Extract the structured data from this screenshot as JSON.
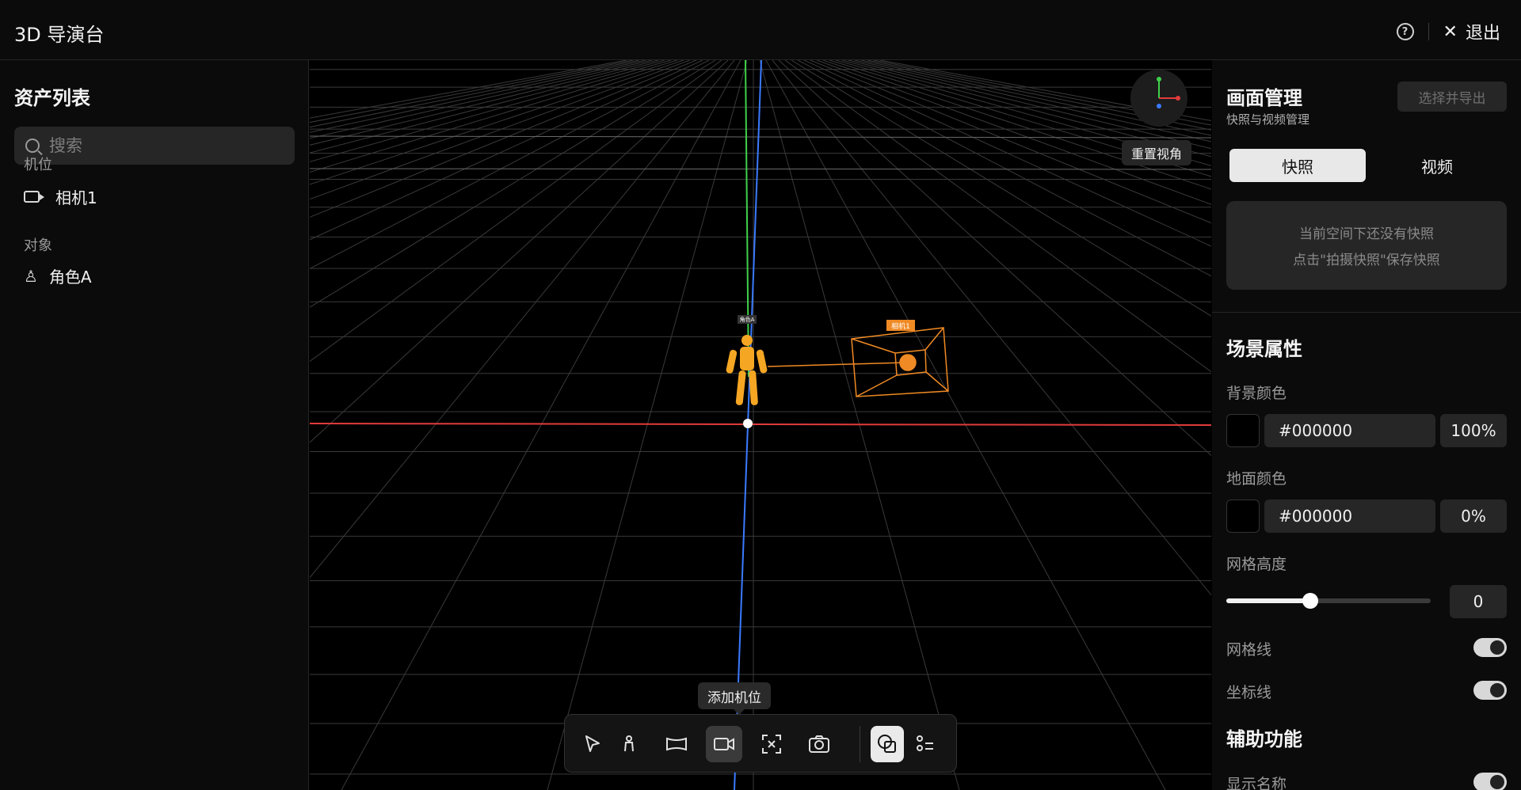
{
  "header": {
    "title": "3D 导演台",
    "exit_label": "退出",
    "help_glyph": "?",
    "close_glyph": "✕"
  },
  "assets": {
    "title": "资产列表",
    "search_placeholder": "搜索",
    "camera_section": "机位",
    "cameras": [
      "相机1"
    ],
    "object_section": "对象",
    "objects": [
      "角色A"
    ]
  },
  "viewport": {
    "reset_view_label": "重置视角",
    "character_tag": "角色A",
    "camera_tag": "相机1",
    "tooltip": "添加机位",
    "colors": {
      "x_axis": "#ff3b3b",
      "y_axis": "#3fd14a",
      "z_axis": "#3b7bff",
      "camera": "#f08a24",
      "character": "#f5a623"
    }
  },
  "toolbar": {
    "tools": [
      "select-icon",
      "character-icon",
      "scene-icon",
      "camera-icon",
      "frame-icon",
      "snapshot-icon",
      "layers-icon",
      "list-icon"
    ],
    "active_tool": "camera-icon"
  },
  "frame_mgmt": {
    "title": "画面管理",
    "subtitle": "快照与视频管理",
    "export_label": "选择并导出",
    "tab_snapshot": "快照",
    "tab_video": "视频",
    "empty_line1": "当前空间下还没有快照",
    "empty_line2": "点击\"拍摄快照\"保存快照"
  },
  "scene_props": {
    "title": "场景属性",
    "bg_label": "背景颜色",
    "bg_hex": "#000000",
    "bg_opacity": "100%",
    "ground_label": "地面颜色",
    "ground_hex": "#000000",
    "ground_opacity": "0%",
    "grid_height_label": "网格高度",
    "grid_height_value": "0",
    "grid_height_slider_fraction": 0.41,
    "grid_lines_label": "网格线",
    "axis_lines_label": "坐标线"
  },
  "aux": {
    "title": "辅助功能",
    "show_names_label": "显示名称"
  }
}
